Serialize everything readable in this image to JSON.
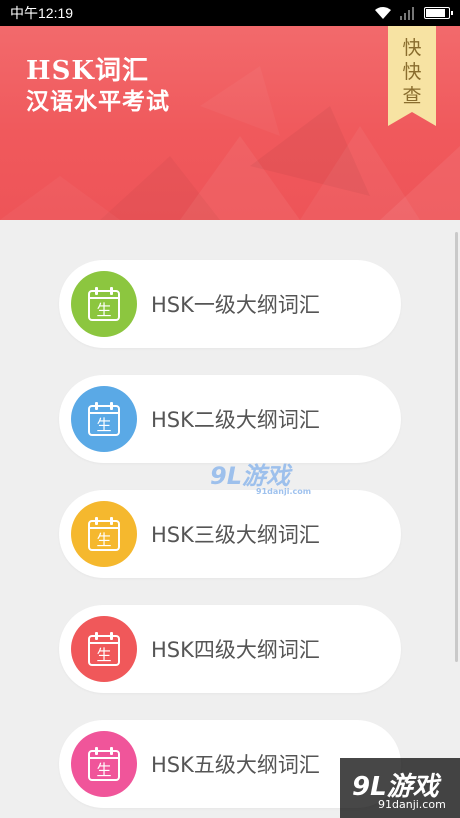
{
  "status_bar": {
    "time": "中午12:19"
  },
  "header": {
    "title_line1": "HSK词汇",
    "title_line2": "汉语水平考试",
    "ribbon_text": "快\n快\n查"
  },
  "levels": [
    {
      "label": "HSK一级大纲词汇",
      "icon_char": "生",
      "color": "#8cc63f"
    },
    {
      "label": "HSK二级大纲词汇",
      "icon_char": "生",
      "color": "#5aa9e6"
    },
    {
      "label": "HSK三级大纲词汇",
      "icon_char": "生",
      "color": "#f5b82e"
    },
    {
      "label": "HSK四级大纲词汇",
      "icon_char": "生",
      "color": "#f0585a"
    },
    {
      "label": "HSK五级大纲词汇",
      "icon_char": "生",
      "color": "#f0559a"
    }
  ],
  "watermark": {
    "center_logo": "9L游戏",
    "center_url": "91danji.com",
    "corner_logo": "9L游戏",
    "corner_url": "91danji.com"
  },
  "colors": {
    "header_red": "#f0595c",
    "ribbon_gold": "#f7e3a3",
    "background": "#efefef"
  }
}
